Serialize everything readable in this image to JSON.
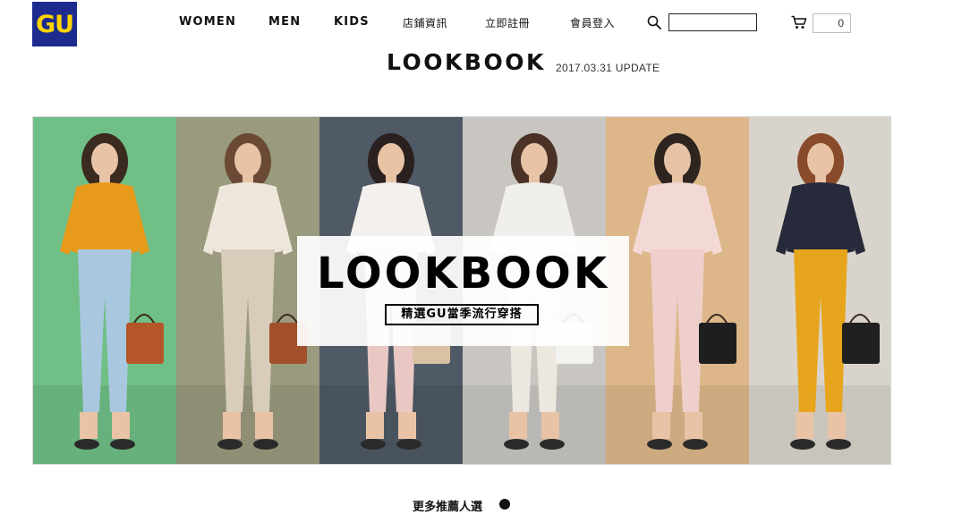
{
  "brand": {
    "logo_text": "GU",
    "logo_bg": "#1d2b8f",
    "logo_fg": "#ffd400"
  },
  "nav": [
    {
      "id": "women",
      "label": "WOMEN"
    },
    {
      "id": "men",
      "label": "MEN"
    },
    {
      "id": "kids",
      "label": "KIDS"
    },
    {
      "id": "stores",
      "label": "店鋪資訊"
    },
    {
      "id": "register",
      "label": "立即註冊"
    },
    {
      "id": "login",
      "label": "會員登入"
    }
  ],
  "search": {
    "icon": "search-icon",
    "value": "",
    "placeholder": ""
  },
  "cart": {
    "icon": "cart-icon",
    "count": "0"
  },
  "page": {
    "title": "LOOKBOOK",
    "update": "2017.03.31 UPDATE"
  },
  "banner": {
    "title": "LOOKBOOK",
    "subtitle": "精選GU當季流行穿搭",
    "panels": [
      {
        "bg": "#6fbf86",
        "top": "#e89a1a",
        "bottom": "#a9c8df",
        "bag": "#b5562a",
        "hair": "#3b2a20"
      },
      {
        "bg": "#9a9a7e",
        "top": "#eee6da",
        "bottom": "#d8cdbb",
        "bag": "#a2502a",
        "hair": "#6a4a34"
      },
      {
        "bg": "#4f5a66",
        "top": "#f3f0ee",
        "bottom": "#e9c8c4",
        "bag": "#d8c2a3",
        "hair": "#2a2020"
      },
      {
        "bg": "#c9c6c2",
        "top": "#f1efeb",
        "bottom": "#ece7df",
        "bag": "#f2f2ee",
        "hair": "#4a3326"
      },
      {
        "bg": "#ddb789",
        "top": "#f3d9d6",
        "bottom": "#efcfcb",
        "bag": "#1e1e1e",
        "hair": "#2e2420"
      },
      {
        "bg": "#d9d4cb",
        "top": "#262a3a",
        "bottom": "#e6a51c",
        "bag": "#202020",
        "hair": "#8a4b2c"
      }
    ]
  },
  "below_fold": {
    "partial_heading": "更多推薦人選"
  }
}
